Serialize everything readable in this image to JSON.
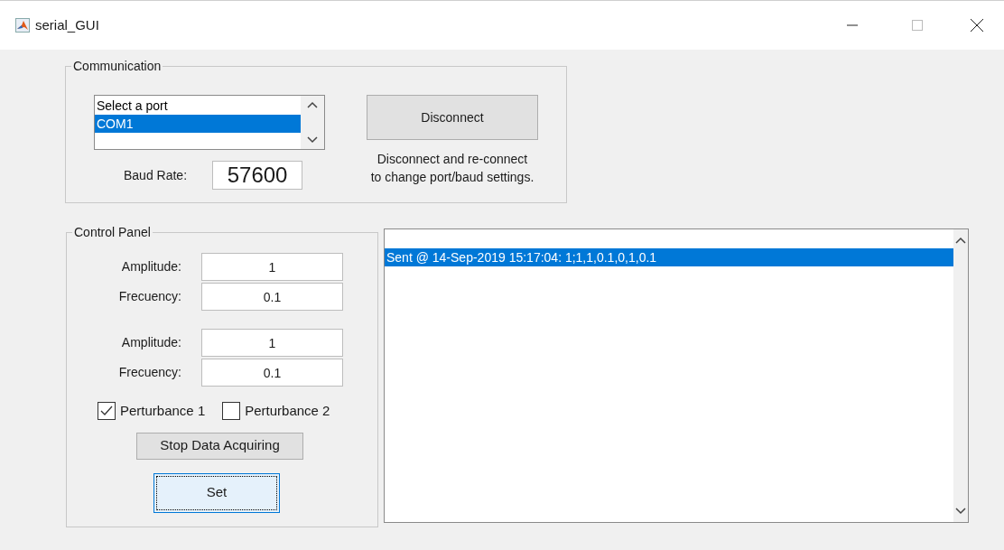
{
  "window": {
    "title": "serial_GUI"
  },
  "communication": {
    "title": "Communication",
    "ports": [
      {
        "label": "Select a port",
        "selected": false
      },
      {
        "label": "COM1",
        "selected": true
      }
    ],
    "disconnect_button": "Disconnect",
    "baud_label": "Baud Rate:",
    "baud_value": "57600",
    "note": [
      "Disconnect and re-connect",
      "to change port/baud settings."
    ]
  },
  "control_panel": {
    "title": "Control Panel",
    "groups": [
      [
        {
          "label": "Amplitude:",
          "value": "1"
        },
        {
          "label": "Frecuency:",
          "value": "0.1"
        }
      ],
      [
        {
          "label": "Amplitude:",
          "value": "1"
        },
        {
          "label": "Frecuency:",
          "value": "0.1"
        }
      ]
    ],
    "checkboxes": [
      {
        "label": "Perturbance 1",
        "checked": true
      },
      {
        "label": "Perturbance 2",
        "checked": false
      }
    ],
    "buttons": [
      {
        "label": "Stop Data Acquiring",
        "focused": false
      },
      {
        "label": "Set",
        "focused": true
      }
    ]
  },
  "log": {
    "items": [
      {
        "text": "Sent @ 14-Sep-2019 15:17:04: 1;1,1,0.1,0,1,0.1",
        "selected": true
      }
    ]
  }
}
